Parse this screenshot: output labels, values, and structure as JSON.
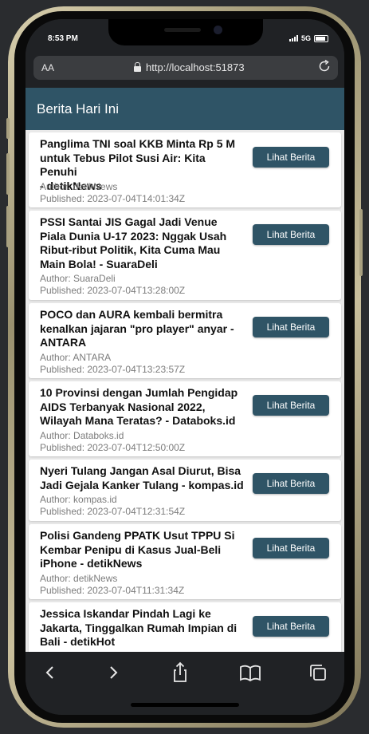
{
  "status": {
    "time": "8:53 PM",
    "network": "5G"
  },
  "browser": {
    "text_size_label": "AA",
    "url": "http://localhost:51873"
  },
  "app": {
    "title": "Berita Hari Ini"
  },
  "news": [
    {
      "title_lines": [
        "Panglima TNI soal KKB Minta Rp 5 M",
        "untuk Tebus Pilot Susi Air: Kita Penuhi",
        "- detikNews"
      ],
      "author": "Author: detikNews",
      "published": "Published: 2023-07-04T14:01:34Z",
      "button": "Lihat Berita"
    },
    {
      "title_lines": [
        "PSSI Santai JIS Gagal Jadi Venue",
        "Piala Dunia U-17 2023: Nggak Usah",
        "Ribut-ribut Politik, Kita Cuma Mau",
        "Main Bola! - SuaraDeli"
      ],
      "author": "Author: SuaraDeli",
      "published": "Published: 2023-07-04T13:28:00Z",
      "button": "Lihat Berita"
    },
    {
      "title_lines": [
        "POCO dan AURA kembali bermitra",
        "kenalkan jajaran \"pro player\" anyar -",
        "ANTARA"
      ],
      "author": "Author: ANTARA",
      "published": "Published: 2023-07-04T13:23:57Z",
      "button": "Lihat Berita"
    },
    {
      "title_lines": [
        "10 Provinsi dengan Jumlah Pengidap",
        "AIDS Terbanyak Nasional 2022,",
        "Wilayah Mana Teratas? - Databoks.id"
      ],
      "author": "Author: Databoks.id",
      "published": "Published: 2023-07-04T12:50:00Z",
      "button": "Lihat Berita"
    },
    {
      "title_lines": [
        "Nyeri Tulang Jangan Asal Diurut, Bisa",
        "Jadi Gejala Kanker Tulang - kompas.id"
      ],
      "author": "Author: kompas.id",
      "published": "Published: 2023-07-04T12:31:54Z",
      "button": "Lihat Berita"
    },
    {
      "title_lines": [
        "Polisi Gandeng PPATK Usut TPPU Si",
        "Kembar Penipu di Kasus Jual-Beli",
        "iPhone - detikNews"
      ],
      "author": "Author: detikNews",
      "published": "Published: 2023-07-04T11:31:34Z",
      "button": "Lihat Berita"
    },
    {
      "title_lines": [
        "Jessica Iskandar Pindah Lagi ke",
        "Jakarta, Tinggalkan Rumah Impian di",
        "Bali - detikHot"
      ],
      "author": "",
      "published": "",
      "button": "Lihat Berita"
    }
  ],
  "toolbar": {
    "back_icon": "chevron-left-icon",
    "forward_icon": "chevron-right-icon",
    "share_icon": "share-icon",
    "bookmarks_icon": "book-icon",
    "tabs_icon": "tabs-icon"
  },
  "colors": {
    "accent": "#2f5466",
    "background": "#eaeaea",
    "card": "#ffffff",
    "chrome": "#202225"
  }
}
